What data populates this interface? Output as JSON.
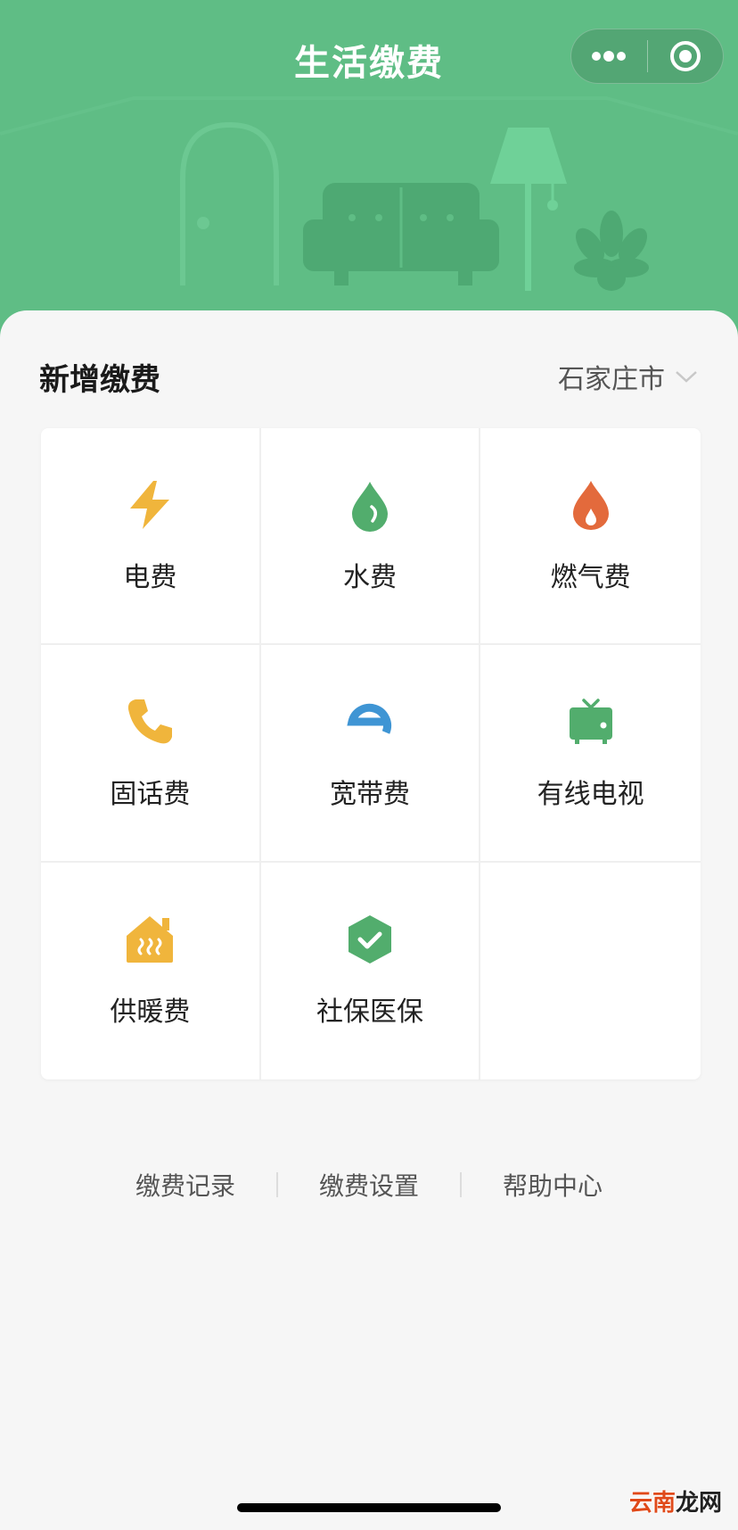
{
  "header": {
    "title": "生活缴费"
  },
  "section": {
    "title": "新增缴费",
    "city": "石家庄市"
  },
  "services": [
    {
      "label": "电费",
      "icon": "lightning-icon",
      "color": "#f0b53c"
    },
    {
      "label": "水费",
      "icon": "water-drop-icon",
      "color": "#52ad6d"
    },
    {
      "label": "燃气费",
      "icon": "flame-icon",
      "color": "#e36a3c"
    },
    {
      "label": "固话费",
      "icon": "phone-icon",
      "color": "#f0b53c"
    },
    {
      "label": "宽带费",
      "icon": "broadband-e-icon",
      "color": "#3f95d4"
    },
    {
      "label": "有线电视",
      "icon": "tv-icon",
      "color": "#52ad6d"
    },
    {
      "label": "供暖费",
      "icon": "heating-house-icon",
      "color": "#f0b53c"
    },
    {
      "label": "社保医保",
      "icon": "shield-check-icon",
      "color": "#52ad6d"
    }
  ],
  "footer": {
    "links": [
      "缴费记录",
      "缴费设置",
      "帮助中心"
    ]
  },
  "watermark": {
    "part1": "云南",
    "part2": "龙网"
  }
}
